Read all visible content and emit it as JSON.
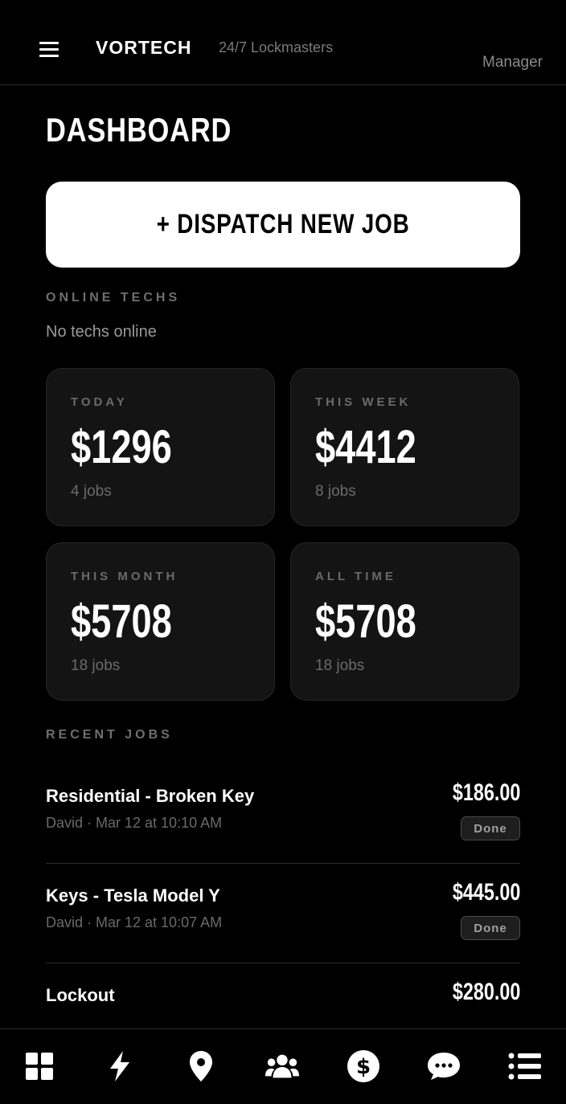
{
  "header": {
    "brand": "VORTECH",
    "tagline": "24/7 Lockmasters",
    "role": "Manager"
  },
  "page": {
    "title": "DASHBOARD",
    "dispatch_label": "+ DISPATCH NEW JOB"
  },
  "online_techs": {
    "label": "ONLINE TECHS",
    "empty_text": "No techs online"
  },
  "stats": [
    {
      "label": "TODAY",
      "amount": "$1296",
      "jobs": "4 jobs"
    },
    {
      "label": "THIS WEEK",
      "amount": "$4412",
      "jobs": "8 jobs"
    },
    {
      "label": "THIS MONTH",
      "amount": "$5708",
      "jobs": "18 jobs"
    },
    {
      "label": "ALL TIME",
      "amount": "$5708",
      "jobs": "18 jobs"
    }
  ],
  "recent_jobs": {
    "label": "RECENT JOBS",
    "items": [
      {
        "title": "Residential - Broken Key",
        "meta": "David · Mar 12 at 10:10 AM",
        "amount": "$186.00",
        "status": "Done"
      },
      {
        "title": "Keys - Tesla Model Y",
        "meta": "David · Mar 12 at 10:07 AM",
        "amount": "$445.00",
        "status": "Done"
      },
      {
        "title": "Lockout",
        "amount": "$280.00"
      }
    ]
  },
  "nav": {
    "icons": [
      "grid-icon",
      "lightning-icon",
      "map-pin-icon",
      "users-icon",
      "dollar-icon",
      "chat-icon",
      "list-icon"
    ]
  }
}
